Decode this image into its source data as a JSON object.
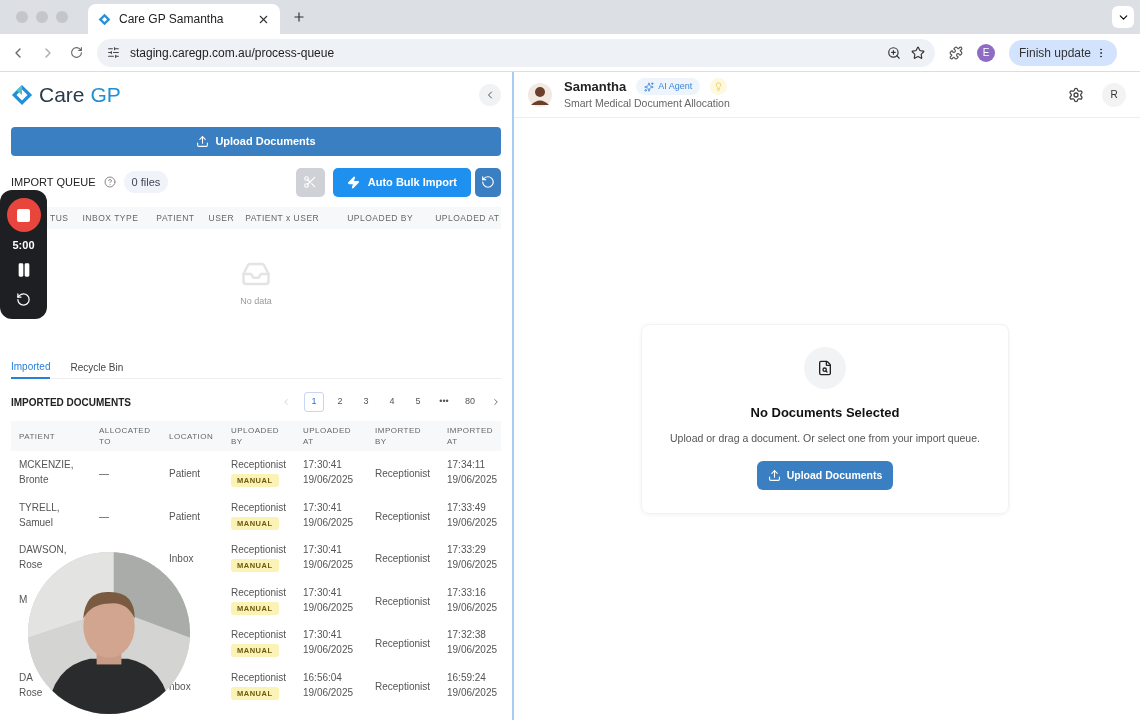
{
  "browser": {
    "tab_title": "Care GP Samantha",
    "url": "staging.caregp.com.au/process-queue",
    "profile_initial": "E",
    "update_button": "Finish update"
  },
  "logo": {
    "text_a": "Care",
    "text_b": "GP"
  },
  "upload_button": "Upload Documents",
  "import_queue": {
    "title": "IMPORT QUEUE",
    "count": "0 files",
    "scissors_disabled": true,
    "auto_import": "Auto Bulk Import",
    "columns": [
      "TUS",
      "INBOX TYPE",
      "PATIENT",
      "USER",
      "PATIENT x USER",
      "UPLOADED BY",
      "UPLOADED AT"
    ],
    "empty_text": "No data"
  },
  "tabs": [
    {
      "label": "Imported",
      "selected": true
    },
    {
      "label": "Recycle Bin",
      "selected": false
    }
  ],
  "imported": {
    "title": "IMPORTED DOCUMENTS",
    "pagination": [
      {
        "label": "1",
        "selected": true
      },
      {
        "label": "2",
        "selected": false
      },
      {
        "label": "3",
        "selected": false
      },
      {
        "label": "4",
        "selected": false
      },
      {
        "label": "5",
        "selected": false
      },
      {
        "label": "•••",
        "selected": false
      },
      {
        "label": "80",
        "selected": false
      }
    ],
    "columns": [
      [
        "PATIENT"
      ],
      [
        "ALLOCATED",
        "TO"
      ],
      [
        "LOCATION"
      ],
      [
        "UPLOADED",
        "BY"
      ],
      [
        "UPLOADED",
        "AT"
      ],
      [
        "IMPORTED",
        "BY"
      ],
      [
        "IMPORTED",
        "AT"
      ]
    ],
    "rows": [
      {
        "patient": [
          "MCKENZIE,",
          "Bronte"
        ],
        "allocated": "—",
        "location": "Patient",
        "uploaded_by": "Receptionist",
        "badge": "MANUAL",
        "uploaded_at": [
          "17:30:41",
          "19/06/2025"
        ],
        "imported_by": "Receptionist",
        "imported_at": [
          "17:34:11",
          "19/06/2025"
        ]
      },
      {
        "patient": [
          "TYRELL,",
          "Samuel"
        ],
        "allocated": "—",
        "location": "Patient",
        "uploaded_by": "Receptionist",
        "badge": "MANUAL",
        "uploaded_at": [
          "17:30:41",
          "19/06/2025"
        ],
        "imported_by": "Receptionist",
        "imported_at": [
          "17:33:49",
          "19/06/2025"
        ]
      },
      {
        "patient": [
          "DAWSON,",
          "Rose"
        ],
        "location": "Inbox",
        "uploaded_by": "Receptionist",
        "badge": "MANUAL",
        "uploaded_at": [
          "17:30:41",
          "19/06/2025"
        ],
        "imported_by": "Receptionist",
        "imported_at": [
          "17:33:29",
          "19/06/2025"
        ]
      },
      {
        "patient": [
          "M"
        ],
        "uploaded_by": "Receptionist",
        "badge": "MANUAL",
        "uploaded_at": [
          "17:30:41",
          "19/06/2025"
        ],
        "imported_by": "Receptionist",
        "imported_at": [
          "17:33:16",
          "19/06/2025"
        ]
      },
      {
        "patient": [],
        "uploaded_by": "Receptionist",
        "badge": "MANUAL",
        "uploaded_at": [
          "17:30:41",
          "19/06/2025"
        ],
        "imported_by": "Receptionist",
        "imported_at": [
          "17:32:38",
          "19/06/2025"
        ]
      },
      {
        "patient": [
          "DA",
          "Rose"
        ],
        "location": "nbox",
        "uploaded_by": "Receptionist",
        "badge": "MANUAL",
        "uploaded_at": [
          "16:56:04",
          "19/06/2025"
        ],
        "imported_by": "Receptionist",
        "imported_at": [
          "16:59:24",
          "19/06/2025"
        ]
      }
    ]
  },
  "agent": {
    "name": "Samantha",
    "badge": "AI Agent",
    "subtitle": "Smart Medical Document Allocation",
    "user_initial": "R"
  },
  "empty_state": {
    "title": "No Documents Selected",
    "text": "Upload or drag a document. Or select one from your import queue.",
    "button": "Upload Documents"
  },
  "recorder": {
    "time": "5:00"
  }
}
